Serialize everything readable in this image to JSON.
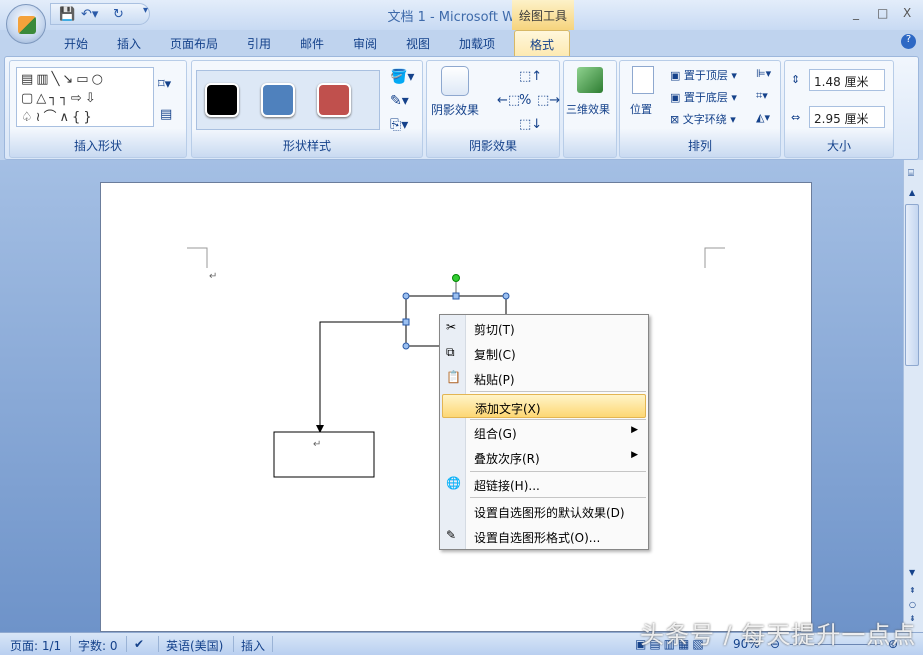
{
  "window": {
    "title": "文档 1 - Microsoft Word",
    "contextual_tab": "绘图工具",
    "minimize": "_",
    "maximize": "□",
    "close": "X",
    "help": "?"
  },
  "tabs": [
    "开始",
    "插入",
    "页面布局",
    "引用",
    "邮件",
    "审阅",
    "视图",
    "加载项",
    "格式"
  ],
  "ribbon": {
    "groups": {
      "insert_shapes": "插入形状",
      "shape_styles": "形状样式",
      "shadow_effects": "阴影效果",
      "three_d": "三维效果",
      "arrange": "排列",
      "size": "大小"
    },
    "shadow_button": "阴影效果",
    "three_d_button": "三维效果",
    "position_button": "位置",
    "bring_front": "置于顶层",
    "send_back": "置于底层",
    "text_wrap": "文字环绕",
    "height_value": "1.48 厘米",
    "width_value": "2.95 厘米",
    "swatch_colors": [
      "#000000",
      "#4f81bd",
      "#c0504d"
    ]
  },
  "context_menu": {
    "items": [
      {
        "label": "剪切(T)",
        "icon": "scissors-icon"
      },
      {
        "label": "复制(C)",
        "icon": "copy-icon"
      },
      {
        "label": "粘贴(P)",
        "icon": "paste-icon"
      },
      {
        "label": "添加文字(X)",
        "highlighted": true
      },
      {
        "label": "组合(G)",
        "submenu": true
      },
      {
        "label": "叠放次序(R)",
        "submenu": true
      },
      {
        "label": "超链接(H)...",
        "icon": "hyperlink-icon"
      },
      {
        "label": "设置自选图形的默认效果(D)"
      },
      {
        "label": "设置自选图形格式(O)...",
        "icon": "format-shape-icon"
      }
    ]
  },
  "document": {
    "paragraph_mark": "↵"
  },
  "status": {
    "page": "页面: 1/1",
    "words": "字数: 0",
    "language": "英语(美国)",
    "mode": "插入",
    "zoom": "90%"
  },
  "watermark": "头条号 / 每天提升一点点"
}
